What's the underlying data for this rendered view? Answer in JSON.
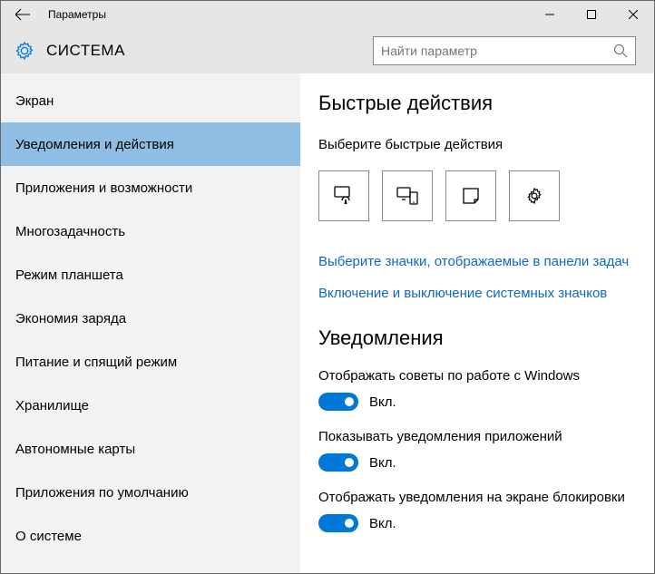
{
  "window": {
    "title": "Параметры"
  },
  "header": {
    "title": "СИСТЕМА"
  },
  "search": {
    "placeholder": "Найти параметр"
  },
  "sidebar": {
    "items": [
      {
        "label": "Экран"
      },
      {
        "label": "Уведомления и действия"
      },
      {
        "label": "Приложения и возможности"
      },
      {
        "label": "Многозадачность"
      },
      {
        "label": "Режим планшета"
      },
      {
        "label": "Экономия заряда"
      },
      {
        "label": "Питание и спящий режим"
      },
      {
        "label": "Хранилище"
      },
      {
        "label": "Автономные карты"
      },
      {
        "label": "Приложения по умолчанию"
      },
      {
        "label": "О системе"
      }
    ]
  },
  "content": {
    "section1_title": "Быстрые действия",
    "section1_sub": "Выберите быстрые действия",
    "qa_icons": [
      "tablet-mode-icon",
      "connect-icon",
      "note-icon",
      "all-settings-icon"
    ],
    "link1": "Выберите значки, отображаемые в панели задач",
    "link2": "Включение и выключение системных значков",
    "section2_title": "Уведомления",
    "settings": [
      {
        "label": "Отображать советы по работе с Windows",
        "state": "Вкл."
      },
      {
        "label": "Показывать уведомления приложений",
        "state": "Вкл."
      },
      {
        "label": "Отображать уведомления на экране блокировки",
        "state": "Вкл."
      }
    ]
  }
}
